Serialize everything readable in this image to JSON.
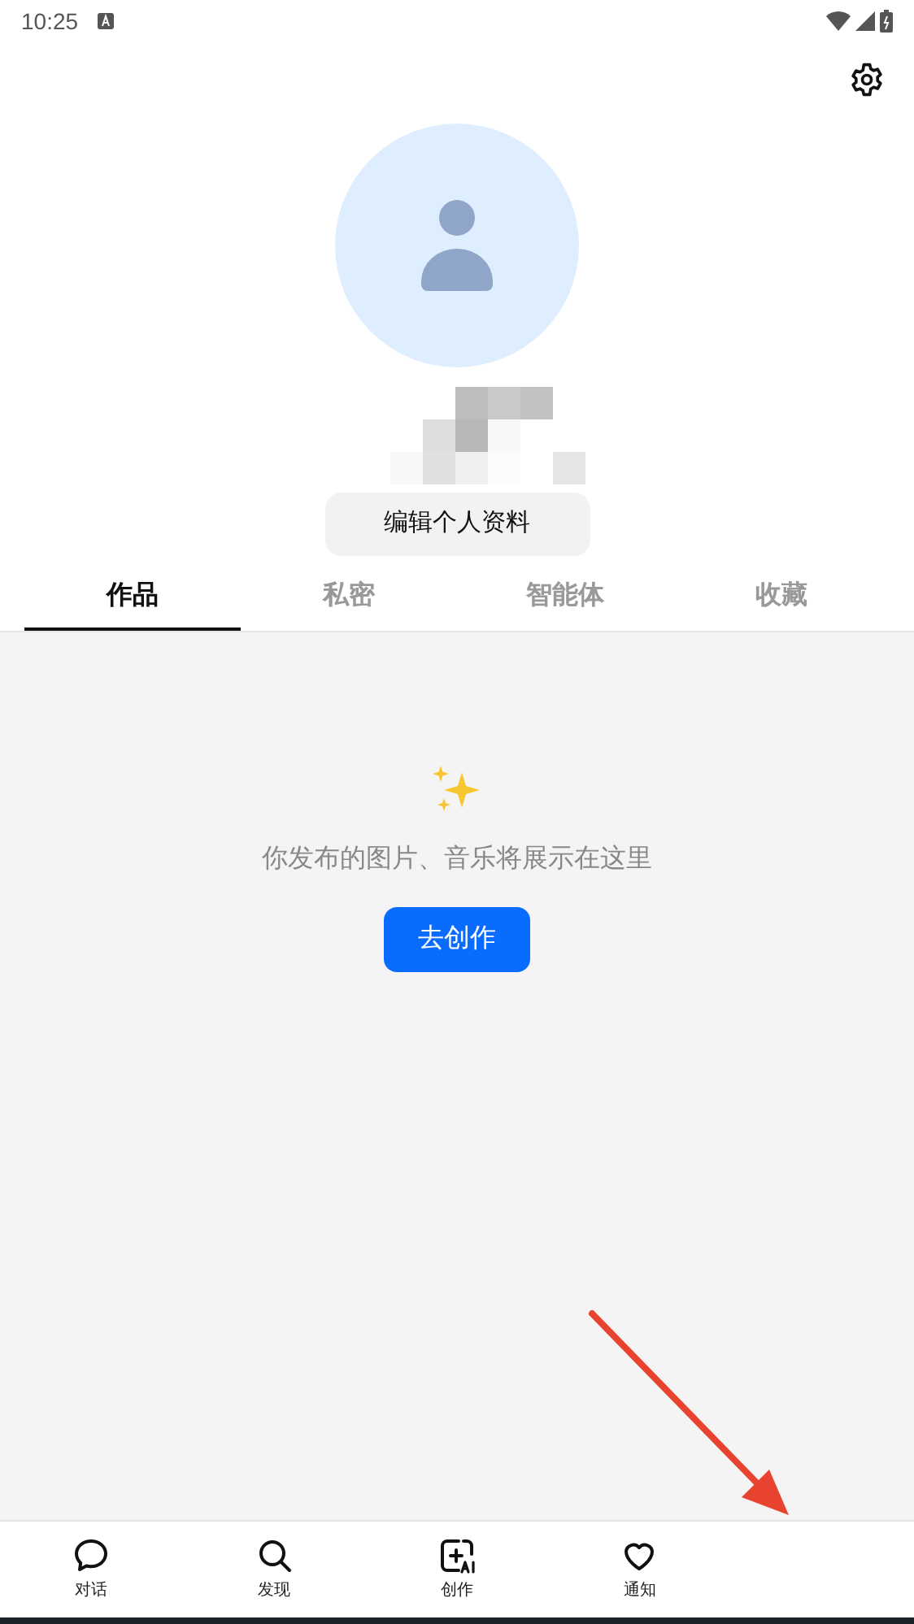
{
  "status_bar": {
    "time": "10:25"
  },
  "profile": {
    "edit_button": "编辑个人资料"
  },
  "tabs": [
    {
      "label": "作品",
      "selected": true
    },
    {
      "label": "私密",
      "selected": false
    },
    {
      "label": "智能体",
      "selected": false
    },
    {
      "label": "收藏",
      "selected": false
    }
  ],
  "empty_state": {
    "message": "你发布的图片、音乐将展示在这里",
    "button": "去创作"
  },
  "bottom_nav": [
    {
      "kind": "chat",
      "label": "对话"
    },
    {
      "kind": "search",
      "label": "发现"
    },
    {
      "kind": "create",
      "label": "创作"
    },
    {
      "kind": "heart",
      "label": "通知"
    }
  ]
}
